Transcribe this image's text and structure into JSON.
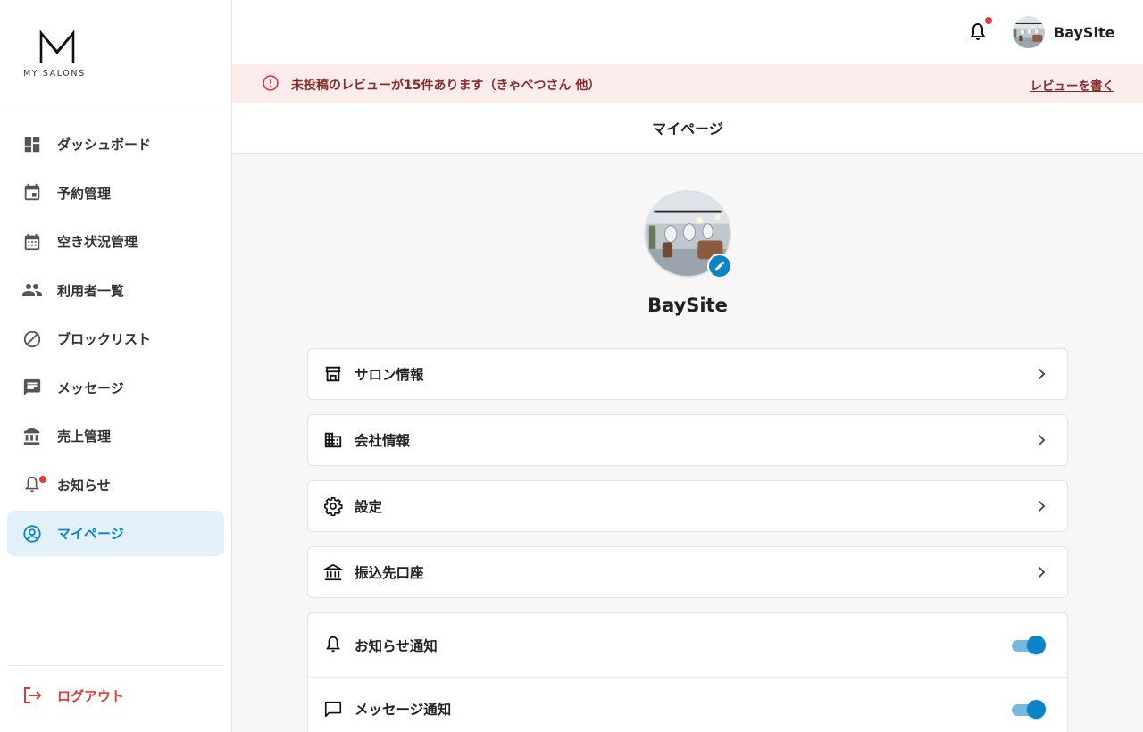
{
  "brand": {
    "logo_text": "MY SALONS"
  },
  "sidebar": {
    "items": [
      {
        "label": "ダッシュボード",
        "icon": "dashboard-icon"
      },
      {
        "label": "予約管理",
        "icon": "calendar-event-icon"
      },
      {
        "label": "空き状況管理",
        "icon": "calendar-month-icon"
      },
      {
        "label": "利用者一覧",
        "icon": "people-icon"
      },
      {
        "label": "ブロックリスト",
        "icon": "block-icon"
      },
      {
        "label": "メッセージ",
        "icon": "message-icon"
      },
      {
        "label": "売上管理",
        "icon": "bank-icon"
      },
      {
        "label": "お知らせ",
        "icon": "bell-icon",
        "has_badge": true
      },
      {
        "label": "マイページ",
        "icon": "account-circle-icon",
        "active": true
      }
    ],
    "logout_label": "ログアウト"
  },
  "header": {
    "user_name": "BaySite",
    "has_notification": true
  },
  "alert": {
    "text": "未投稿のレビューが15件あります（きゃべつさん 他）",
    "link_label": "レビューを書く"
  },
  "page": {
    "title": "マイページ"
  },
  "profile": {
    "name": "BaySite"
  },
  "menu": [
    {
      "label": "サロン情報",
      "icon": "store-icon"
    },
    {
      "label": "会社情報",
      "icon": "building-icon"
    },
    {
      "label": "設定",
      "icon": "gear-icon"
    },
    {
      "label": "振込先口座",
      "icon": "bank-icon"
    }
  ],
  "notifications": [
    {
      "label": "お知らせ通知",
      "icon": "bell-icon",
      "enabled": true
    },
    {
      "label": "メッセージ通知",
      "icon": "chat-icon",
      "enabled": true
    }
  ],
  "colors": {
    "accent": "#0a84c9",
    "active_bg": "#e3f1fb",
    "alert_bg": "#fdecec",
    "alert_text": "#8a2a2a",
    "danger": "#e53935"
  }
}
